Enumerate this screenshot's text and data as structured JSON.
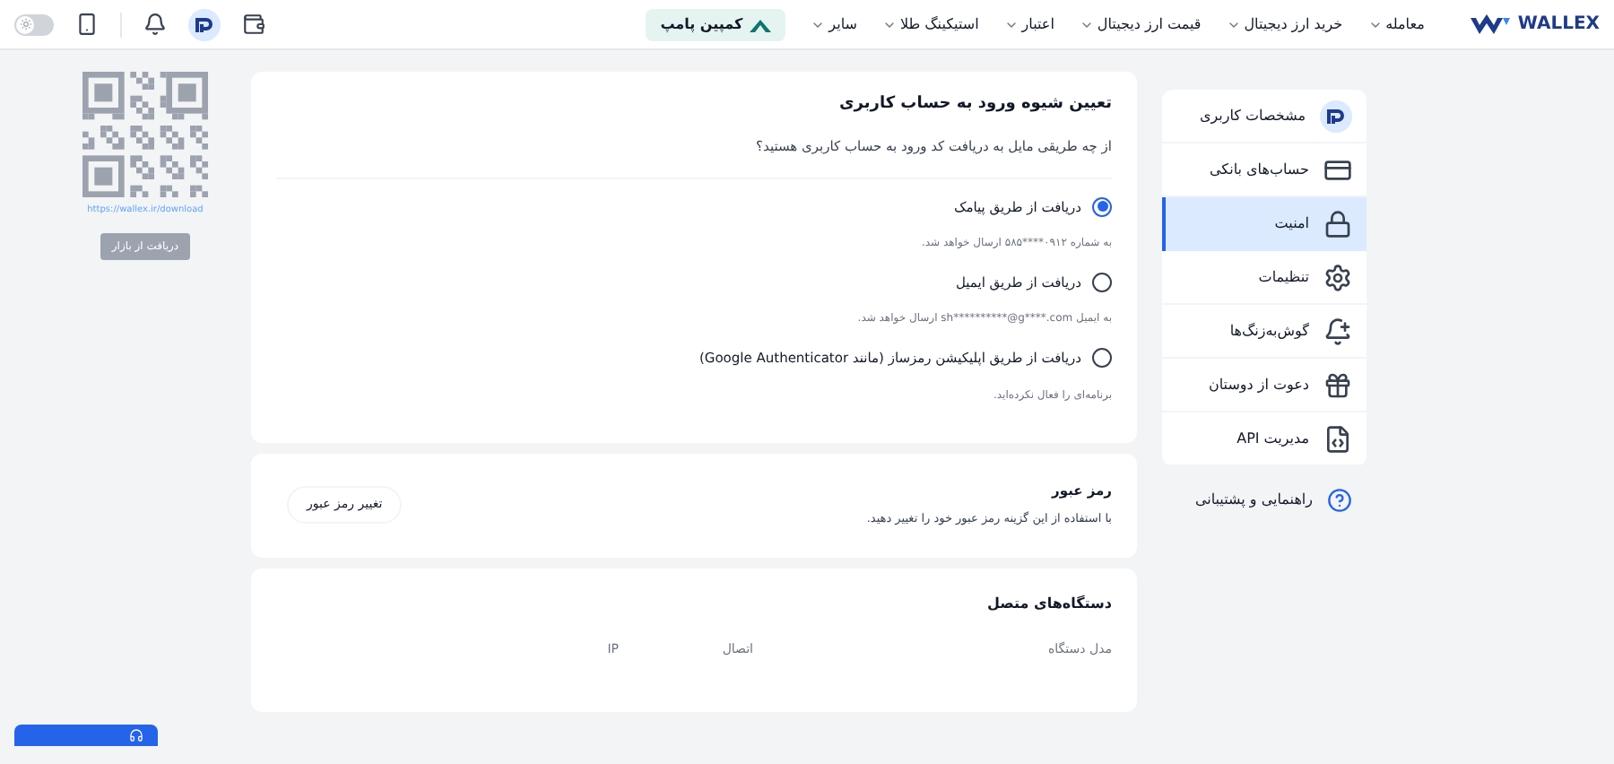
{
  "header": {
    "logo": "WALLEX",
    "nav": [
      {
        "label": "معامله"
      },
      {
        "label": "خرید ارز دیجیتال"
      },
      {
        "label": "قیمت ارز دیجیتال"
      },
      {
        "label": "اعتبار"
      },
      {
        "label": "استیکینگ طلا"
      },
      {
        "label": "سایر"
      }
    ],
    "campaign": "کمپین پامپ",
    "theme_toggle": {
      "on": false
    }
  },
  "download": {
    "url": "https://wallex.ir/download",
    "store_badge": "دریافت از بازار"
  },
  "sidebar": {
    "items": [
      {
        "label": "مشخصات کاربری",
        "selected": false
      },
      {
        "label": "حساب‌های بانکی",
        "selected": false
      },
      {
        "label": "امنیت",
        "selected": true
      },
      {
        "label": "تنظیمات",
        "selected": false
      },
      {
        "label": "گوش‌به‌زنگ‌ها",
        "selected": false
      },
      {
        "label": "دعوت از دوستان",
        "selected": false
      },
      {
        "label": "مدیریت API",
        "selected": false
      }
    ],
    "help": "راهنمایی و پشتیبانی"
  },
  "login_method": {
    "title": "تعیین شیوه ورود به حساب کاربری",
    "question": "از چه طریقی مایل به دریافت کد ورود به حساب کاربری هستید؟",
    "options": [
      {
        "label": "دریافت از طریق پیامک",
        "note": "به شماره ۰۹۱۲****۵۸۵ ارسال خواهد شد.",
        "selected": true
      },
      {
        "label": "دریافت از طریق ایمیل",
        "note": "به ایمیل sh**********@g****.com ارسال خواهد شد.",
        "selected": false
      },
      {
        "label": "دریافت از طریق اپلیکیشن رمزساز (مانند Google Authenticator)",
        "note": "برنامه‌ای را فعال نکرده‌اید.",
        "selected": false
      }
    ]
  },
  "password": {
    "title": "رمز عبور",
    "description": "با استفاده از این گزینه رمز عبور خود را تغییر دهید.",
    "button": "تغییر رمز عبور"
  },
  "devices": {
    "title": "دستگاه‌های متصل",
    "columns": [
      "مدل دستگاه",
      "اتصال",
      "IP"
    ]
  }
}
